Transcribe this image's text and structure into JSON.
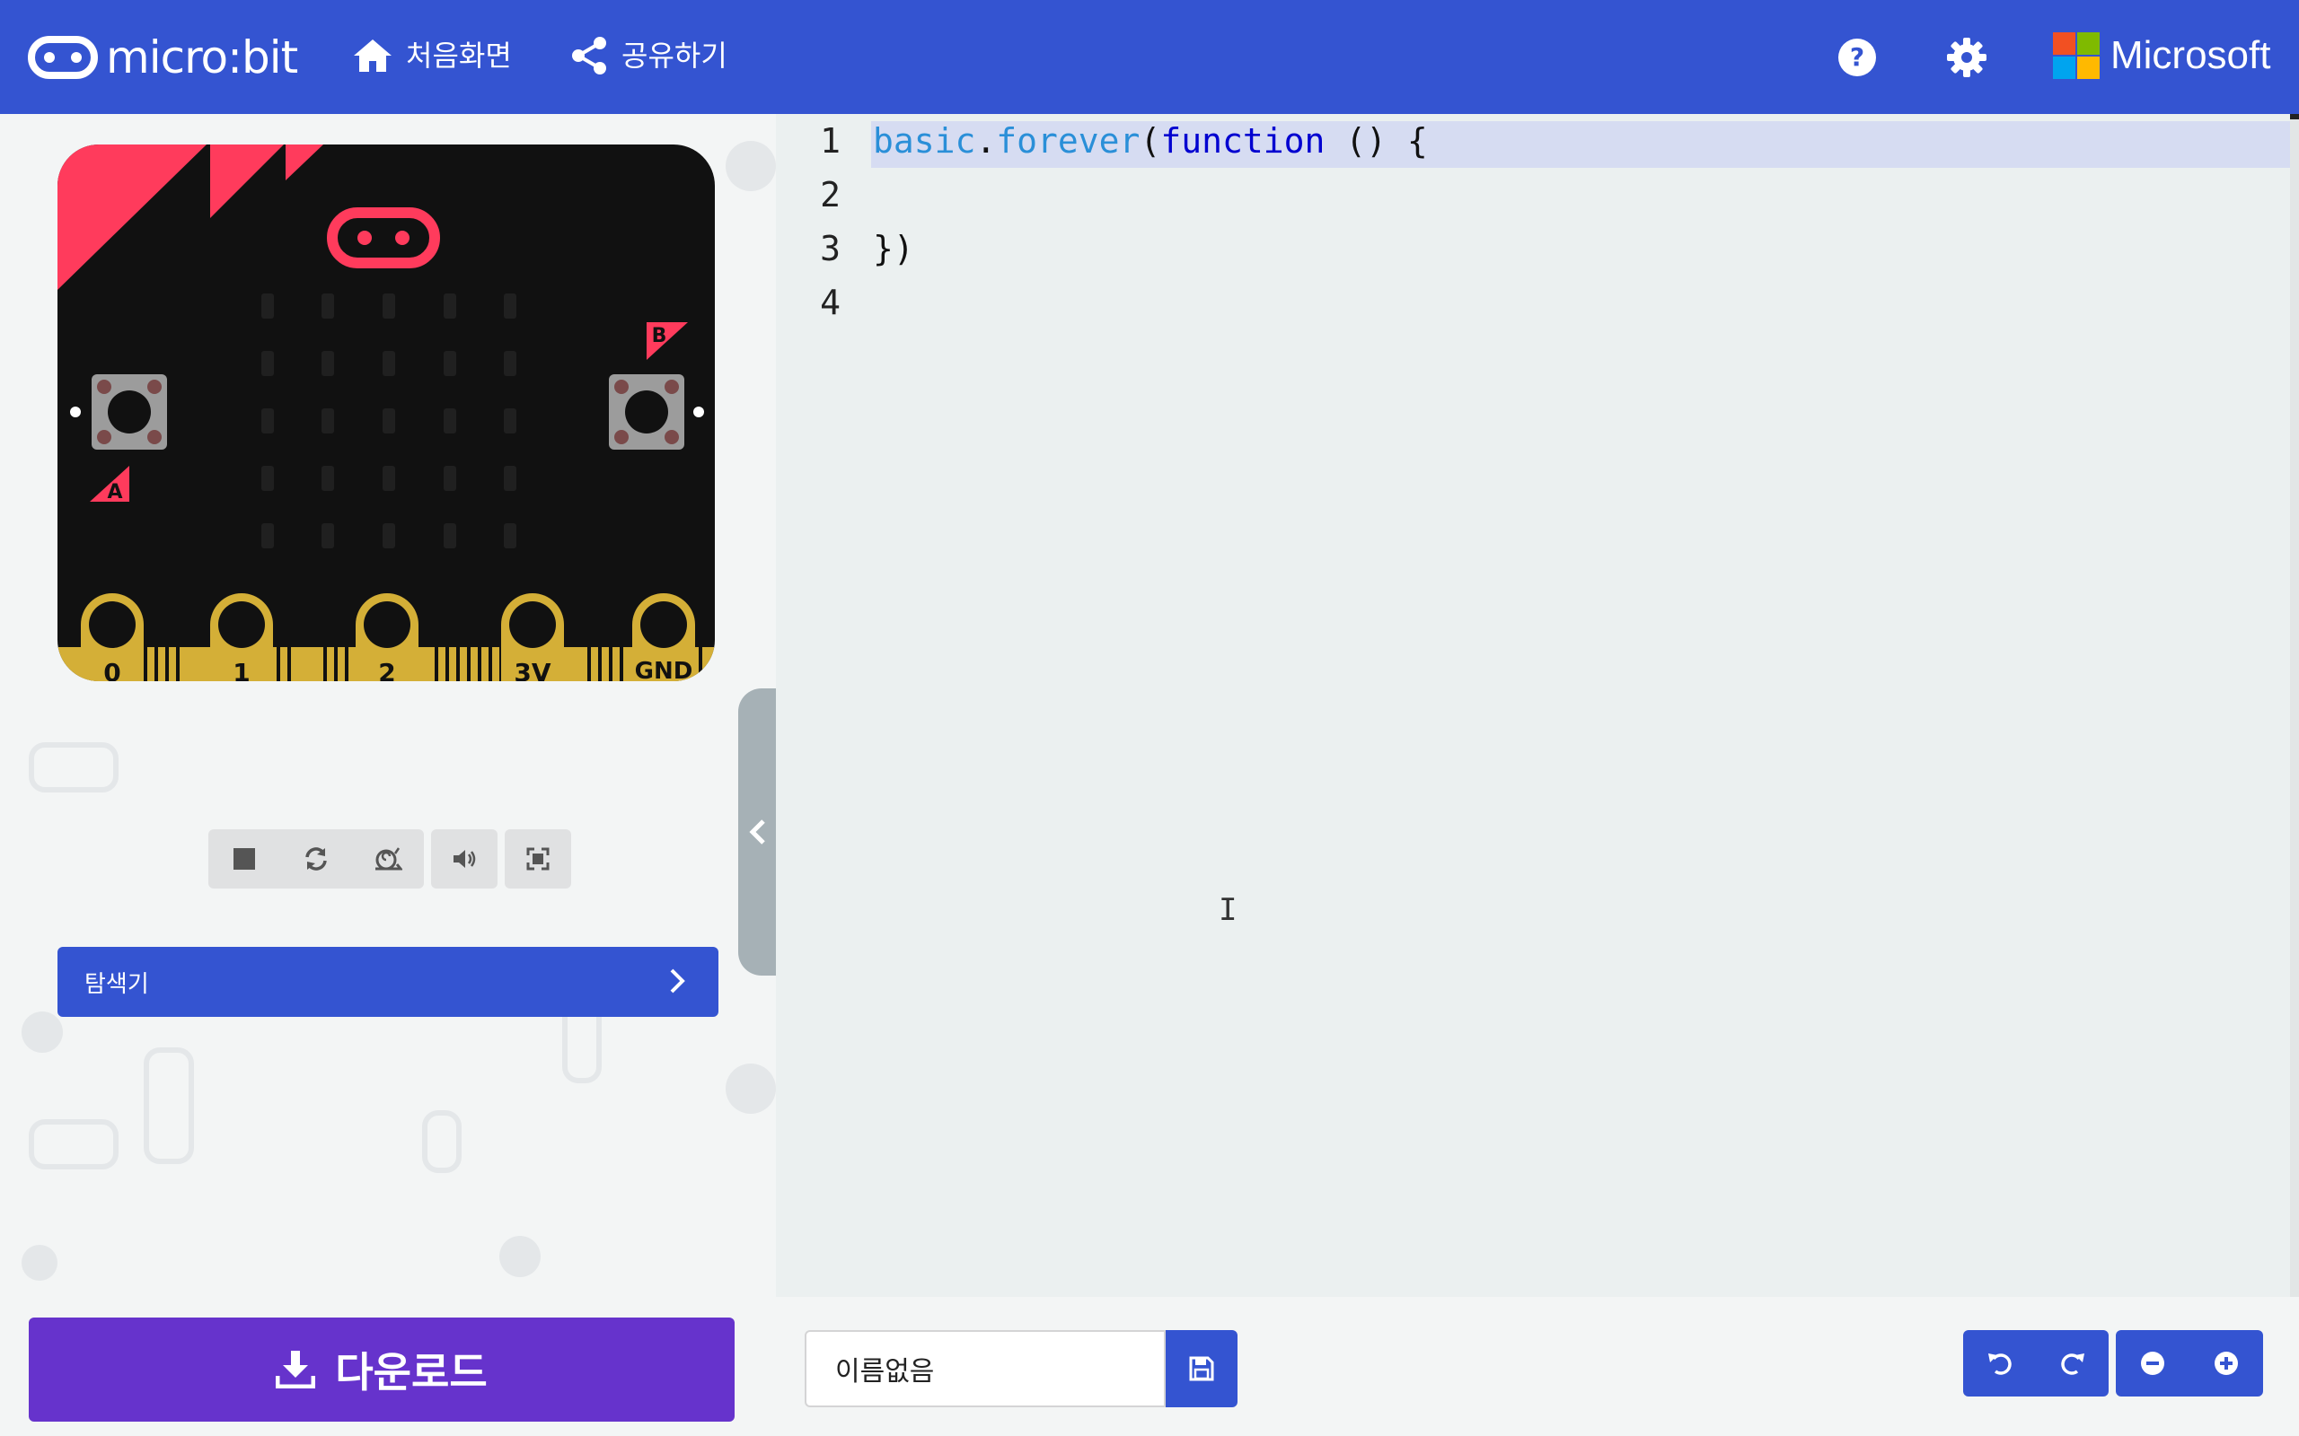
{
  "header": {
    "logo_text": "micro:bit",
    "home_label": "처음화면",
    "share_label": "공유하기",
    "help_icon": "help-icon",
    "settings_icon": "gear-icon",
    "microsoft_label": "Microsoft"
  },
  "simulator": {
    "button_a": "A",
    "button_b": "B",
    "pins": [
      "0",
      "1",
      "2",
      "3V",
      "GND"
    ],
    "toolbar": [
      "stop-icon",
      "restart-icon",
      "slow-motion-icon",
      "sound-icon",
      "fullscreen-icon"
    ]
  },
  "explorer": {
    "label": "탐색기"
  },
  "editor": {
    "line_numbers": [
      "1",
      "2",
      "3",
      "4"
    ],
    "code": {
      "l1_obj": "basic",
      "l1_dot": ".",
      "l1_method": "forever",
      "l1_paren": "(",
      "l1_kw": "function",
      "l1_rest": " () {",
      "l2": "",
      "l3": "})",
      "l4": ""
    },
    "cursor_glyph": "I"
  },
  "footer": {
    "download_label": "다운로드",
    "project_name": "이름없음"
  },
  "colors": {
    "header_bg": "#3454d1",
    "download_bg": "#6633cc",
    "board_accent": "#ff3b5c",
    "board_gold": "#d4af37"
  }
}
